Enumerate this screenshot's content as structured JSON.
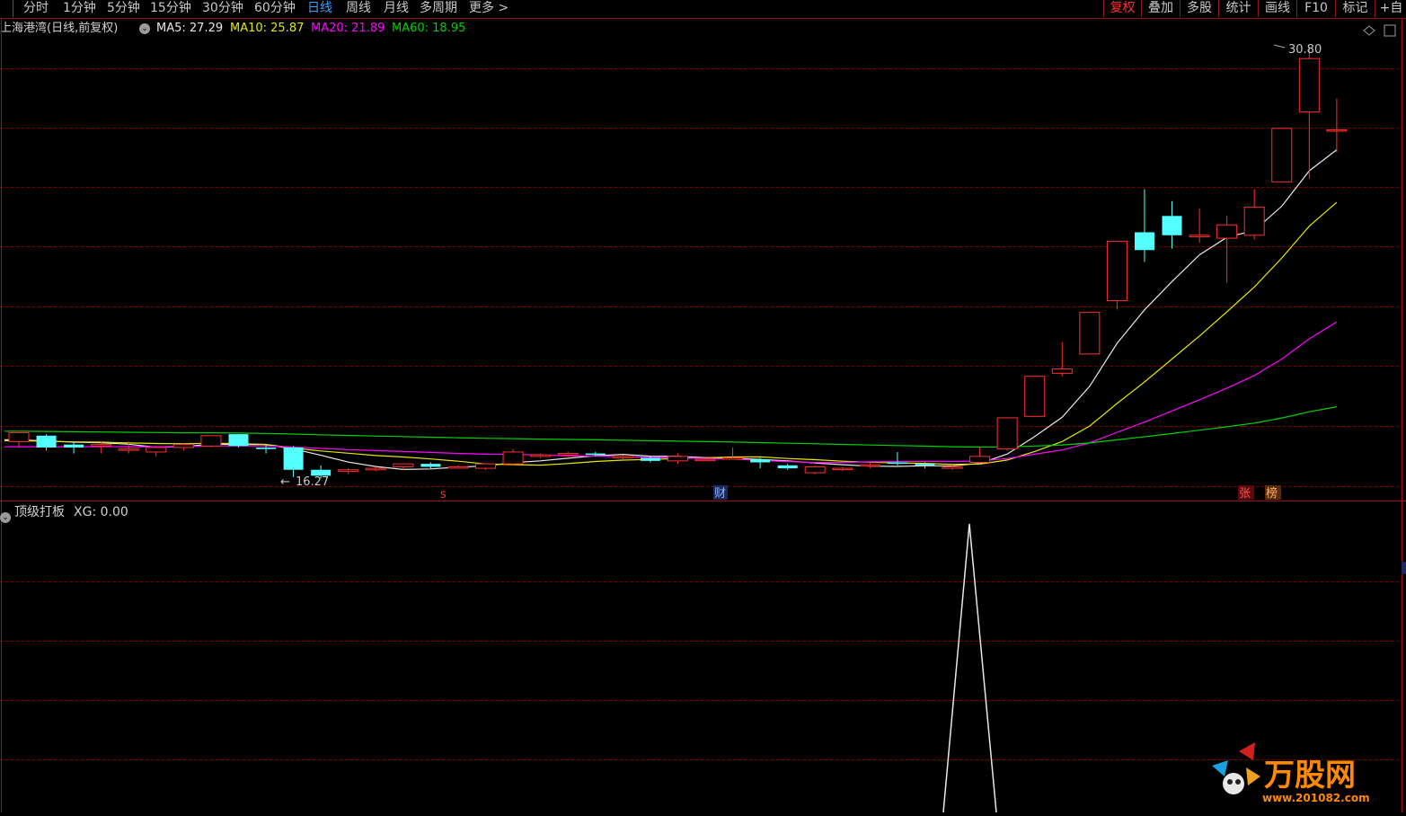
{
  "toolbar": {
    "tabs": [
      {
        "label": "分时",
        "active": false
      },
      {
        "label": "1分钟",
        "active": false
      },
      {
        "label": "5分钟",
        "active": false
      },
      {
        "label": "15分钟",
        "active": false
      },
      {
        "label": "30分钟",
        "active": false
      },
      {
        "label": "60分钟",
        "active": false
      },
      {
        "label": "日线",
        "active": true
      },
      {
        "label": "周线",
        "active": false
      },
      {
        "label": "月线",
        "active": false
      },
      {
        "label": "多周期",
        "active": false
      },
      {
        "label": "更多 >",
        "active": false
      }
    ],
    "right_tabs": [
      {
        "label": "复权",
        "active": true
      },
      {
        "label": "叠加",
        "active": false
      },
      {
        "label": "多股",
        "active": false
      },
      {
        "label": "统计",
        "active": false
      },
      {
        "label": "画线",
        "active": false
      },
      {
        "label": "F10",
        "active": false
      },
      {
        "label": "标记",
        "active": false
      },
      {
        "label": "+自",
        "active": false
      }
    ]
  },
  "chart_header": {
    "title": "上海港湾(日线,前复权)",
    "ma5": "MA5: 27.29",
    "ma10": "MA10: 25.87",
    "ma20": "MA20: 21.89",
    "ma60": "MA60: 18.95",
    "ma_icon": "settings-circle-icon",
    "diamond_icon": "diamond-icon"
  },
  "colors": {
    "up": "#ff3030",
    "down": "#54ffff",
    "ma5": "#e8e8e8",
    "ma10": "#e6e600",
    "ma20": "#ff00ff",
    "ma60": "#00d000",
    "grid": "#7a0000",
    "active_tab": "#3aa0ff"
  },
  "markers": {
    "high_label": "30.80",
    "low_label": "16.27",
    "s_marker": "s",
    "cai_marker": "财",
    "zhang_marker": "张",
    "bang_marker": "榜"
  },
  "indicator": {
    "label": "顶级打板",
    "value_text": "XG: 0.00",
    "icon": "collapse-circle-icon"
  },
  "watermark": {
    "brand": "万股网",
    "url": "www.201082.com"
  },
  "chart_data": {
    "type": "candlestick",
    "price_high": 30.8,
    "price_low": 16.27,
    "ma_last": {
      "MA5": 27.29,
      "MA10": 25.87,
      "MA20": 21.89,
      "MA60": 18.95
    },
    "candles": [
      [
        17.5,
        17.8,
        17.3,
        17.65
      ],
      [
        17.7,
        17.3,
        17.2,
        17.75
      ],
      [
        17.4,
        17.3,
        17.1,
        17.5
      ],
      [
        17.35,
        17.4,
        17.1,
        17.5
      ],
      [
        17.25,
        17.25,
        17.1,
        17.5
      ],
      [
        17.15,
        17.3,
        17.0,
        17.35
      ],
      [
        17.3,
        17.4,
        17.2,
        17.45
      ],
      [
        17.35,
        17.7,
        17.3,
        17.7
      ],
      [
        17.75,
        17.35,
        17.3,
        17.75
      ],
      [
        17.3,
        17.25,
        17.1,
        17.4
      ],
      [
        17.3,
        16.55,
        16.3,
        17.35
      ],
      [
        16.55,
        16.35,
        16.27,
        16.7
      ],
      [
        16.5,
        16.55,
        16.4,
        16.6
      ],
      [
        16.55,
        16.6,
        16.5,
        16.65
      ],
      [
        16.65,
        16.75,
        16.55,
        16.75
      ],
      [
        16.75,
        16.65,
        16.6,
        16.8
      ],
      [
        16.65,
        16.65,
        16.6,
        16.7
      ],
      [
        16.6,
        16.75,
        16.55,
        16.75
      ],
      [
        16.75,
        17.15,
        16.7,
        17.25
      ],
      [
        17.0,
        17.05,
        16.95,
        17.1
      ],
      [
        17.05,
        17.1,
        17.0,
        17.15
      ],
      [
        17.1,
        17.05,
        17.0,
        17.15
      ],
      [
        17.0,
        17.0,
        16.9,
        17.05
      ],
      [
        16.95,
        16.85,
        16.8,
        17.0
      ],
      [
        16.85,
        17.0,
        16.75,
        17.1
      ],
      [
        16.9,
        16.9,
        16.85,
        16.95
      ],
      [
        16.95,
        16.95,
        16.9,
        17.3
      ],
      [
        16.9,
        16.8,
        16.6,
        16.95
      ],
      [
        16.7,
        16.6,
        16.55,
        16.75
      ],
      [
        16.45,
        16.65,
        16.4,
        16.7
      ],
      [
        16.6,
        16.6,
        16.5,
        16.65
      ],
      [
        16.7,
        16.72,
        16.6,
        16.8
      ],
      [
        16.8,
        16.75,
        16.7,
        17.15
      ],
      [
        16.75,
        16.7,
        16.6,
        16.8
      ],
      [
        16.6,
        16.65,
        16.55,
        16.7
      ],
      [
        16.8,
        17.0,
        16.75,
        17.3
      ],
      [
        17.25,
        18.3,
        17.2,
        18.3
      ],
      [
        18.35,
        19.7,
        18.35,
        19.7
      ],
      [
        19.8,
        19.95,
        19.7,
        20.85
      ],
      [
        20.45,
        21.85,
        20.45,
        21.85
      ],
      [
        22.25,
        24.25,
        21.95,
        24.25
      ],
      [
        24.55,
        23.95,
        23.55,
        26.0
      ],
      [
        25.1,
        24.45,
        24.0,
        25.6
      ],
      [
        24.4,
        24.45,
        24.2,
        25.35
      ],
      [
        24.35,
        24.8,
        22.85,
        25.1
      ],
      [
        24.45,
        25.4,
        24.3,
        26.0
      ],
      [
        26.25,
        28.05,
        26.25,
        28.05
      ],
      [
        28.6,
        30.4,
        26.35,
        30.8
      ],
      [
        28.0,
        28.0,
        27.25,
        29.05
      ]
    ]
  }
}
